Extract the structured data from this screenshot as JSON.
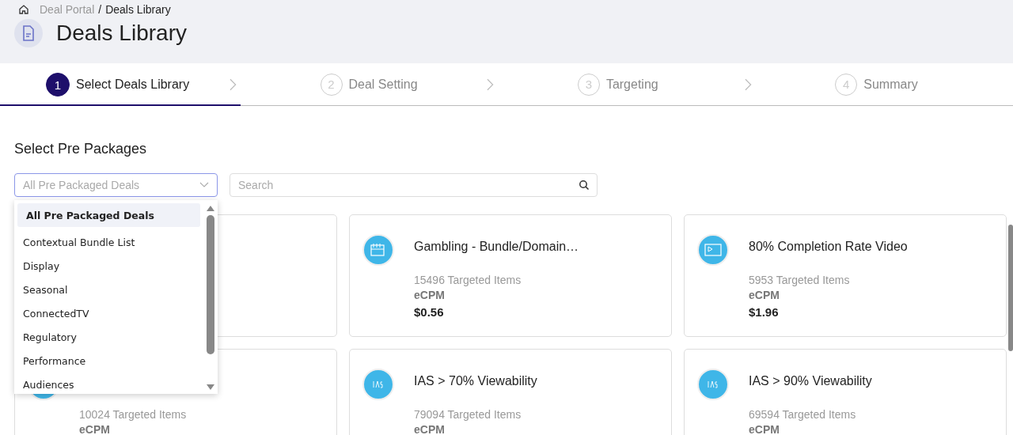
{
  "breadcrumb": [
    {
      "label": "Deal Portal",
      "current": false
    },
    {
      "label": "Deals Library",
      "current": true
    }
  ],
  "breadcrumb_separator": "/",
  "page_title": "Deals Library",
  "steps": [
    {
      "number": "1",
      "label": "Select Deals Library",
      "selected": true
    },
    {
      "number": "2",
      "label": "Deal Setting",
      "selected": false
    },
    {
      "number": "3",
      "label": "Targeting",
      "selected": false
    },
    {
      "number": "4",
      "label": "Summary",
      "selected": false
    }
  ],
  "section_title": "Select Pre Packages",
  "filter": {
    "placeholder": "All Pre Packaged Deals",
    "expanded": true,
    "options": [
      {
        "label": "All Pre Packaged Deals",
        "selected": true
      },
      {
        "label": "Contextual Bundle List",
        "selected": false
      },
      {
        "label": "Display",
        "selected": false
      },
      {
        "label": "Seasonal",
        "selected": false
      },
      {
        "label": "ConnectedTV",
        "selected": false
      },
      {
        "label": "Regulatory",
        "selected": false
      },
      {
        "label": "Performance",
        "selected": false
      },
      {
        "label": "Audiences",
        "selected": false
      }
    ]
  },
  "search": {
    "placeholder": "Search"
  },
  "cards": [
    {
      "kind": "blank"
    },
    {
      "kind": "calendar",
      "title": "Gambling - Bundle/Domain…",
      "items": "15496 Targeted Items",
      "metric": "eCPM",
      "price": "$0.56"
    },
    {
      "kind": "video",
      "title": "80% Completion Rate Video",
      "items": "5953 Targeted Items",
      "metric": "eCPM",
      "price": "$1.96"
    },
    {
      "kind": "blank",
      "items": "10024 Targeted Items",
      "metric": "eCPM"
    },
    {
      "kind": "ias",
      "title": "IAS > 70% Viewability",
      "items": "79094 Targeted Items",
      "metric": "eCPM"
    },
    {
      "kind": "ias",
      "title": "IAS > 90% Viewability",
      "items": "69594 Targeted Items",
      "metric": "eCPM"
    }
  ]
}
